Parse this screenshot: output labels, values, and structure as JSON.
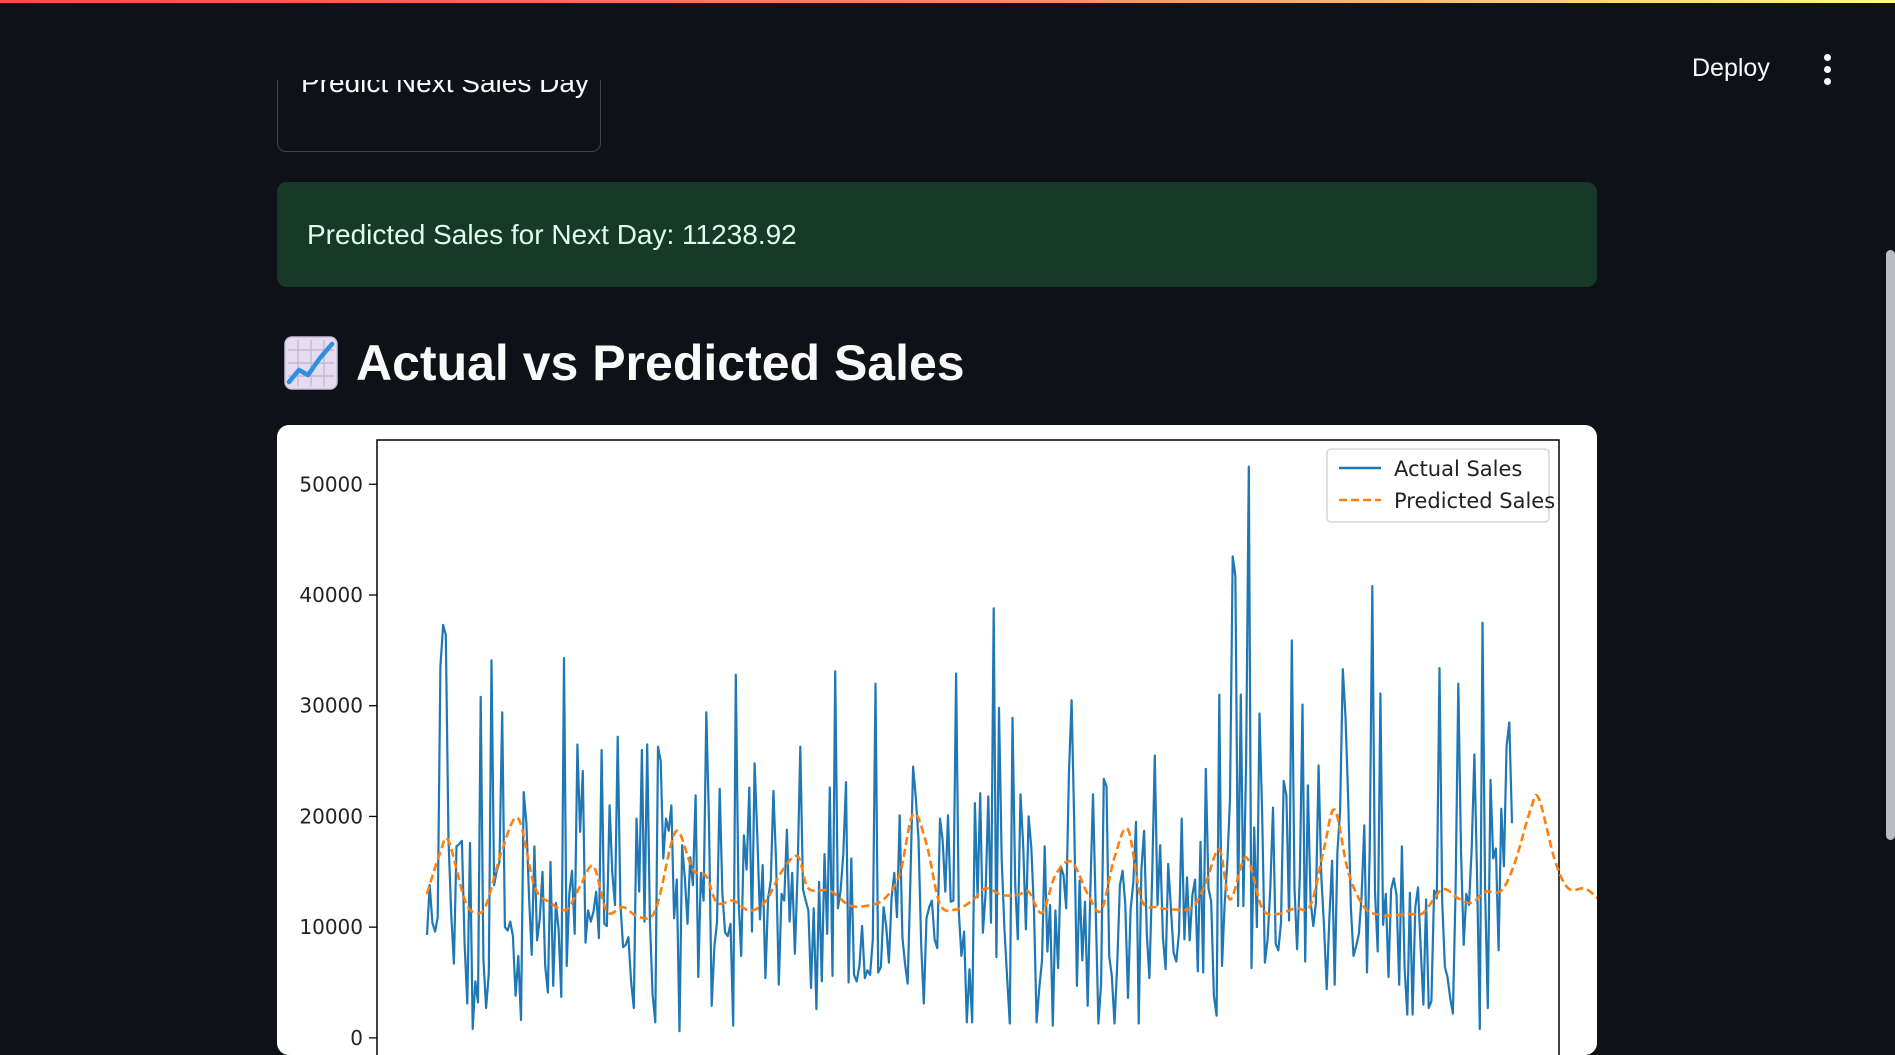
{
  "header": {
    "deploy_label": "Deploy",
    "menu_icon": "more-vertical-icon"
  },
  "predict_button": {
    "label": "Predict Next Sales Day"
  },
  "result": {
    "text": "Predicted Sales for Next Day: 11238.92"
  },
  "section": {
    "icon": "chart-increasing-icon",
    "title": "Actual vs Predicted Sales"
  },
  "colors": {
    "actual": "#1f77b4",
    "predicted": "#ff7f0e",
    "success_bg": "#173928",
    "app_bg": "#0e1117"
  },
  "chart_data": {
    "type": "line",
    "ylim": [
      -2000,
      54000
    ],
    "yticks": [
      0,
      10000,
      20000,
      30000,
      40000,
      50000
    ],
    "grid": false,
    "legend_placement": "upper-right",
    "series": [
      {
        "name": "Actual Sales",
        "style": "solid",
        "values": [
          9300,
          13800,
          10400,
          9600,
          10900,
          33500,
          37300,
          36400,
          17900,
          11200,
          6700,
          17300,
          17500,
          17800,
          8500,
          3100,
          17600,
          800,
          5100,
          3200,
          30800,
          7100,
          2700,
          5800,
          34100,
          13800,
          15100,
          15900,
          29400,
          10000,
          9700,
          10500,
          9200,
          3800,
          7400,
          1600,
          22200,
          19400,
          12600,
          7500,
          17300,
          8800,
          10800,
          15000,
          6500,
          4100,
          15900,
          4700,
          12200,
          9800,
          3700,
          34300,
          6500,
          13000,
          15100,
          9400,
          26500,
          18600,
          24100,
          8600,
          11500,
          10500,
          11400,
          13200,
          9000,
          26000,
          10300,
          10100,
          21000,
          14900,
          12000,
          27200,
          12100,
          8200,
          8400,
          9100,
          5100,
          2700,
          19800,
          13200,
          26000,
          10500,
          26500,
          10600,
          3900,
          1400,
          26300,
          25000,
          16200,
          19800,
          18700,
          21000,
          10800,
          14300,
          600,
          17400,
          14500,
          10300,
          16300,
          13800,
          21900,
          5500,
          14900,
          12400,
          29400,
          19500,
          2900,
          8300,
          10400,
          22500,
          13000,
          9500,
          9200,
          10300,
          1100,
          32800,
          12600,
          7400,
          18300,
          15200,
          22600,
          9600,
          24800,
          18300,
          10700,
          15600,
          5400,
          12600,
          14200,
          22300,
          15900,
          4800,
          13000,
          12400,
          18800,
          10500,
          14900,
          7600,
          15000,
          26300,
          13400,
          12400,
          11500,
          4500,
          11700,
          2600,
          14100,
          5100,
          16600,
          9400,
          22600,
          5600,
          33100,
          11700,
          13300,
          16600,
          23100,
          5000,
          16200,
          5700,
          5100,
          6500,
          10100,
          5400,
          6100,
          5700,
          8900,
          32000,
          5900,
          6400,
          11800,
          10100,
          6800,
          12700,
          14900,
          10900,
          20100,
          9100,
          6700,
          4900,
          14300,
          24500,
          21700,
          18000,
          8400,
          3100,
          10800,
          11800,
          12400,
          8900,
          8100,
          19800,
          17900,
          13200,
          20100,
          12300,
          12400,
          32900,
          11400,
          7400,
          9600,
          1400,
          6200,
          1400,
          21200,
          12700,
          22100,
          9500,
          13100,
          21800,
          10400,
          38800,
          7300,
          29800,
          16100,
          9900,
          5500,
          1300,
          28900,
          13900,
          8900,
          22000,
          17400,
          9800,
          20000,
          17200,
          11500,
          1400,
          4500,
          7000,
          17300,
          7800,
          12000,
          1100,
          11500,
          6300,
          15500,
          14700,
          11700,
          23800,
          30500,
          19500,
          4700,
          14200,
          7000,
          12300,
          2900,
          13500,
          22000,
          11700,
          1300,
          4900,
          23400,
          22700,
          7400,
          5600,
          1300,
          6600,
          13800,
          15100,
          12000,
          3600,
          11600,
          14000,
          19500,
          1300,
          15200,
          18700,
          9400,
          5400,
          14300,
          25500,
          12000,
          17400,
          9100,
          6200,
          15700,
          11700,
          7700,
          6900,
          9500,
          19800,
          8900,
          14500,
          8800,
          12900,
          14300,
          6000,
          17700,
          5900,
          24300,
          13500,
          12300,
          3800,
          2000,
          31000,
          6500,
          12000,
          15800,
          21600,
          43500,
          41700,
          11900,
          31000,
          11900,
          24700,
          51600,
          6300,
          19000,
          10000,
          29300,
          20100,
          6800,
          8900,
          13500,
          20800,
          8500,
          7900,
          10400,
          23200,
          21900,
          10600,
          35900,
          13500,
          8000,
          14500,
          30100,
          6900,
          22800,
          12300,
          10100,
          12200,
          24600,
          14600,
          10100,
          4400,
          10900,
          16000,
          4800,
          16800,
          20500,
          33300,
          29000,
          21500,
          11700,
          7400,
          8300,
          9400,
          12800,
          19200,
          5900,
          16900,
          40800,
          13200,
          7800,
          31100,
          10200,
          13000,
          5500,
          13400,
          14400,
          12900,
          4800,
          17300,
          6300,
          2100,
          13100,
          2100,
          11800,
          13600,
          8100,
          3000,
          12500,
          2700,
          3300,
          13300,
          12600,
          33400,
          12300,
          6400,
          5500,
          3600,
          2200,
          13400,
          32000,
          16900,
          8400,
          13000,
          12000,
          17100,
          25600,
          14400,
          800,
          37500,
          13300,
          2700,
          23300,
          16200,
          17100,
          7900,
          20700,
          15500,
          26400,
          28500,
          19400
        ]
      },
      {
        "name": "Predicted Sales",
        "style": "dashed",
        "anchors": [
          [
            0,
            13000
          ],
          [
            5,
            16800
          ],
          [
            8,
            17800
          ],
          [
            14,
            12500
          ],
          [
            18,
            11300
          ],
          [
            22,
            12000
          ],
          [
            28,
            17000
          ],
          [
            34,
            19800
          ],
          [
            40,
            13700
          ],
          [
            46,
            12200
          ],
          [
            52,
            11600
          ],
          [
            57,
            13700
          ],
          [
            62,
            15500
          ],
          [
            67,
            11400
          ],
          [
            73,
            11800
          ],
          [
            79,
            10900
          ],
          [
            85,
            11500
          ],
          [
            91,
            17600
          ],
          [
            94,
            18500
          ],
          [
            99,
            15200
          ],
          [
            104,
            14600
          ],
          [
            108,
            12200
          ],
          [
            114,
            12400
          ],
          [
            120,
            11500
          ],
          [
            126,
            12300
          ],
          [
            132,
            15000
          ],
          [
            138,
            16400
          ],
          [
            142,
            13500
          ],
          [
            150,
            13300
          ],
          [
            157,
            12000
          ],
          [
            163,
            11900
          ],
          [
            170,
            12500
          ],
          [
            176,
            14800
          ],
          [
            181,
            20200
          ],
          [
            186,
            17500
          ],
          [
            191,
            12100
          ],
          [
            197,
            11600
          ],
          [
            203,
            12400
          ],
          [
            208,
            13500
          ],
          [
            214,
            12900
          ],
          [
            220,
            12900
          ],
          [
            224,
            13200
          ],
          [
            229,
            11300
          ],
          [
            234,
            14700
          ],
          [
            240,
            15900
          ],
          [
            246,
            13000
          ],
          [
            251,
            11500
          ],
          [
            256,
            16300
          ],
          [
            261,
            18800
          ],
          [
            266,
            12500
          ],
          [
            272,
            11800
          ],
          [
            278,
            11600
          ],
          [
            285,
            11800
          ],
          [
            290,
            14000
          ],
          [
            295,
            17000
          ],
          [
            299,
            12500
          ],
          [
            305,
            16300
          ],
          [
            311,
            11700
          ],
          [
            317,
            11200
          ],
          [
            323,
            11700
          ],
          [
            329,
            12000
          ],
          [
            334,
            17100
          ],
          [
            338,
            20600
          ],
          [
            343,
            15000
          ],
          [
            349,
            11800
          ],
          [
            355,
            11100
          ],
          [
            361,
            11100
          ],
          [
            366,
            11200
          ],
          [
            371,
            11300
          ],
          [
            378,
            13400
          ],
          [
            384,
            12600
          ],
          [
            389,
            12200
          ],
          [
            394,
            13200
          ],
          [
            400,
            13300
          ],
          [
            405,
            15800
          ],
          [
            411,
            20700
          ],
          [
            414,
            21600
          ],
          [
            420,
            16000
          ],
          [
            425,
            13500
          ],
          [
            431,
            13500
          ],
          [
            435,
            12800
          ],
          [
            440,
            11600
          ],
          [
            444,
            11100
          ]
        ]
      }
    ]
  }
}
